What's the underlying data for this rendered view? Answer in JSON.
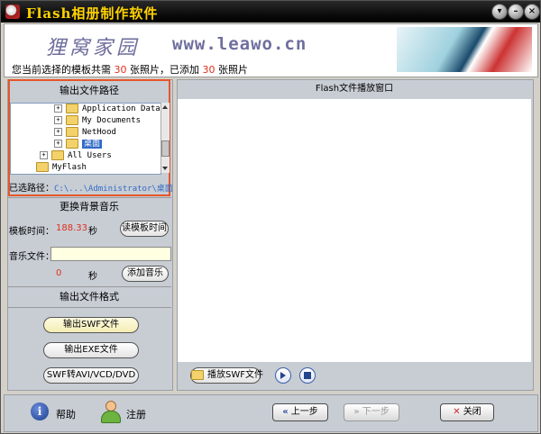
{
  "window": {
    "title": "Flash相册制作软件",
    "controls": [
      "▾",
      "–",
      "×"
    ]
  },
  "header": {
    "logo_text": "狸窝家园",
    "logo_url": "www.leawo.cn",
    "status_prefix": "您当前选择的模板共需",
    "status_required": "30",
    "status_mid": "张照片，已添加",
    "status_added": "30",
    "status_suffix": "张照片"
  },
  "left_panel": {
    "output_path_title": "输出文件路径",
    "tree": [
      {
        "label": "Application Data",
        "expander": "+"
      },
      {
        "label": "My Documents",
        "expander": "+"
      },
      {
        "label": "NetHood",
        "expander": "+"
      },
      {
        "label": "桌面",
        "expander": "+",
        "selected": true
      },
      {
        "label": "All Users",
        "expander": "+"
      },
      {
        "label": "MyFlash",
        "expander": ""
      }
    ],
    "selected_path_label": "已选路径：",
    "selected_path_value": "C:\\...\\Administrator\\桌面",
    "music_title": "更换背景音乐",
    "template_time_label": "模板时间：",
    "template_time_value": "188.33",
    "template_time_unit": "秒",
    "read_template_time_button": "读模板时间",
    "music_file_label": "音乐文件：",
    "music_file_value": "",
    "music_duration_value": "0",
    "music_duration_unit": "秒",
    "add_music_button": "添加音乐",
    "output_format_title": "输出文件格式",
    "output_swf_button": "输出SWF文件",
    "output_exe_button": "输出EXE文件",
    "swf_to_video_button": "SWF转AVI/VCD/DVD"
  },
  "flash_panel": {
    "title": "Flash文件播放窗口",
    "play_button": "播放SWF文件"
  },
  "footer": {
    "help_label": "帮助",
    "register_label": "注册",
    "prev_button": "上一步",
    "next_button": "下一步",
    "close_button": "关闭"
  },
  "colors": {
    "title_text": "#FFD200",
    "highlight_red": "#E0301E",
    "outline_orange": "#E5562A",
    "selection_blue": "#316AC5"
  }
}
